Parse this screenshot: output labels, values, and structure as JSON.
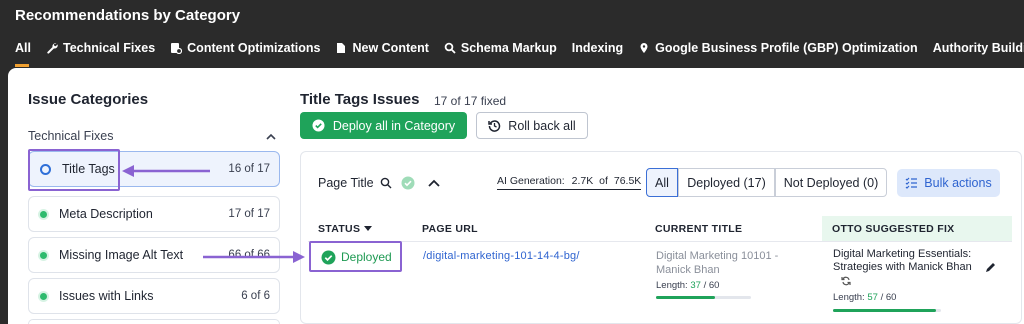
{
  "header": {
    "title": "Recommendations by Category",
    "tabs": [
      {
        "label": "All",
        "icon": "none"
      },
      {
        "label": "Technical Fixes",
        "icon": "wrench-icon"
      },
      {
        "label": "Content Optimizations",
        "icon": "content-icon"
      },
      {
        "label": "New Content",
        "icon": "file-icon"
      },
      {
        "label": "Schema Markup",
        "icon": "search-icon"
      },
      {
        "label": "Indexing",
        "icon": "none"
      },
      {
        "label": "Google Business Profile (GBP) Optimization",
        "icon": "pin-icon"
      },
      {
        "label": "Authority Building (Hyp",
        "icon": "none"
      }
    ]
  },
  "sidebar": {
    "title": "Issue Categories",
    "section_label": "Technical Fixes",
    "items": [
      {
        "label": "Title Tags",
        "count": "16 of 17",
        "state": "active"
      },
      {
        "label": "Meta Description",
        "count": "17 of 17",
        "state": "done"
      },
      {
        "label": "Missing Image Alt Text",
        "count": "66 of 66",
        "state": "done"
      },
      {
        "label": "Issues with Links",
        "count": "6 of 6",
        "state": "done"
      }
    ]
  },
  "main": {
    "title": "Title Tags Issues",
    "subtitle": "17 of 17 fixed",
    "deploy_all_label": "Deploy all in Category",
    "rollback_label": "Roll back all",
    "filter_label": "Page Title",
    "ai_generation_label": "AI Generation:",
    "ai_generation_value": "2.7K",
    "ai_generation_of": "of",
    "ai_generation_total": "76.5K",
    "segments": [
      "All",
      "Deployed (17)",
      "Not Deployed (0)"
    ],
    "bulk_actions_label": "Bulk actions"
  },
  "table": {
    "headers": {
      "status": "STATUS",
      "page_url": "PAGE URL",
      "current_title": "CURRENT TITLE",
      "otto_fix": "OTTO SUGGESTED FIX"
    },
    "rows": [
      {
        "status": "Deployed",
        "url": "/digital-marketing-101-14-4-bg/",
        "current_title": "Digital Marketing 10101 - Manick Bhan",
        "current_length_label": "Length:",
        "current_length": "37",
        "current_length_max": "/ 60",
        "current_fill": 0.62,
        "otto_title": "Digital Marketing Essentials: Strategies with Manick Bhan",
        "otto_length_label": "Length:",
        "otto_length": "57",
        "otto_length_max": "/ 60",
        "otto_fill": 0.95
      }
    ]
  },
  "colors": {
    "accent_green": "#1fa35a",
    "accent_blue": "#2f64d0",
    "annotation_purple": "#8a63d2"
  }
}
